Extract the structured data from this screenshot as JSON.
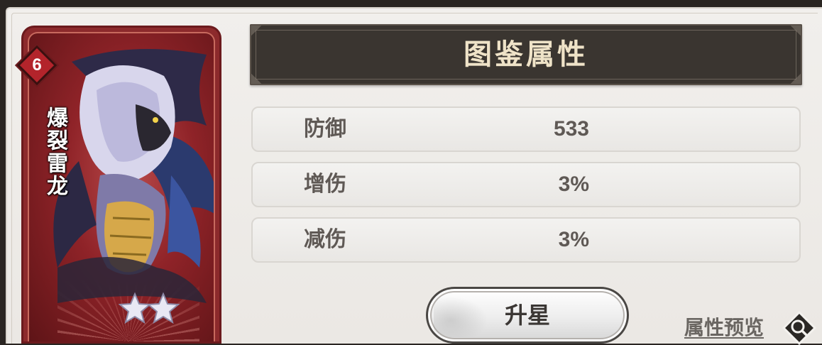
{
  "card": {
    "level": "6",
    "name": "爆裂雷龙",
    "stars": 2
  },
  "panel": {
    "title": "图鉴属性"
  },
  "stats": [
    {
      "label": "防御",
      "value": "533"
    },
    {
      "label": "增伤",
      "value": "3%"
    },
    {
      "label": "减伤",
      "value": "3%"
    }
  ],
  "actions": {
    "upgrade_label": "升星",
    "preview_label": "属性预览"
  },
  "icons": {
    "preview": "search-icon",
    "star": "star-icon"
  },
  "colors": {
    "card_red": "#8c2a2c",
    "title_bar": "#3a3530",
    "title_text": "#efe3c8"
  }
}
